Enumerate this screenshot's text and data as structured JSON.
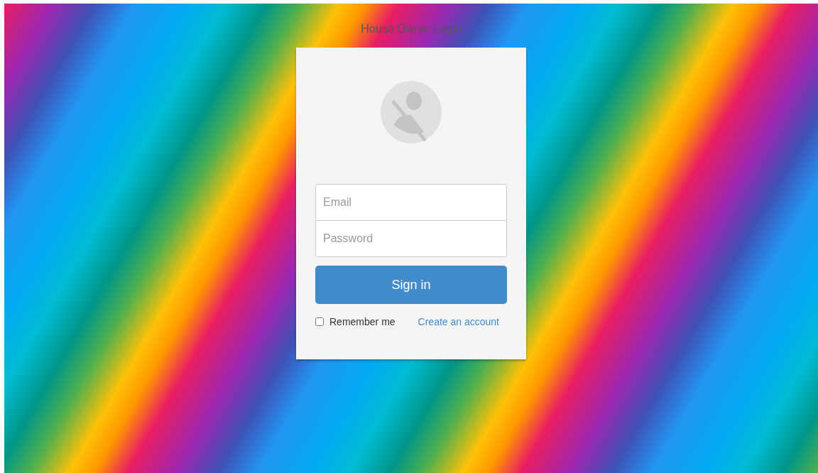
{
  "page_title": "House Owner Login",
  "login_form": {
    "email": {
      "placeholder": "Email"
    },
    "password": {
      "placeholder": "Password"
    },
    "submit_button": "Sign in",
    "remember_me": {
      "label": "Remember me",
      "checked": false
    },
    "create_account_link": "Create an account"
  }
}
